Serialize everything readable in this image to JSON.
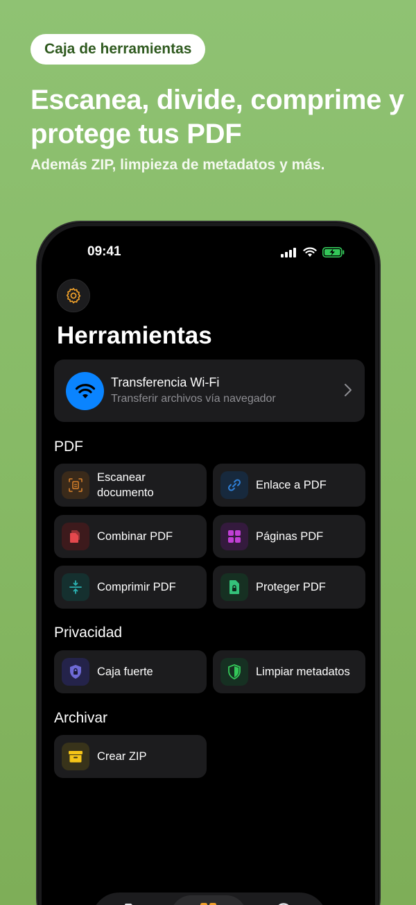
{
  "promo": {
    "badge": "Caja de herramientas",
    "headline": "Escanea, divide, comprime y protege tus PDF",
    "subline": "Además ZIP, limpieza de metadatos y más."
  },
  "status_bar": {
    "time": "09:41"
  },
  "app": {
    "title": "Herramientas",
    "wifi_card": {
      "title": "Transferencia Wi-Fi",
      "subtitle": "Transferir archivos vía navegador"
    },
    "sections": {
      "pdf": "PDF",
      "privacy": "Privacidad",
      "archive": "Archivar"
    },
    "tools": {
      "scan": "Escanear documento",
      "link_to_pdf": "Enlace a PDF",
      "merge": "Combinar PDF",
      "pages": "Páginas PDF",
      "compress": "Comprimir PDF",
      "protect": "Proteger PDF",
      "vault": "Caja fuerte",
      "clean_metadata": "Limpiar metadatos",
      "zip": "Crear ZIP"
    }
  },
  "colors": {
    "accent_blue": "#0a84ff",
    "scan": "#d9822b",
    "link": "#2f7fd6",
    "merge": "#e5484d",
    "pages": "#c13fd6",
    "compress": "#2bb3b3",
    "protect": "#34c27a",
    "vault": "#6e6ad6",
    "clean": "#34c759",
    "zip": "#f5c518",
    "gear": "#f0a12a"
  },
  "icons": [
    "gear-icon",
    "wifi-icon",
    "chevron-right-icon",
    "scan-icon",
    "link-icon",
    "merge-icon",
    "grid-icon",
    "compress-icon",
    "lock-file-icon",
    "shield-lock-icon",
    "shield-icon",
    "archive-icon"
  ]
}
